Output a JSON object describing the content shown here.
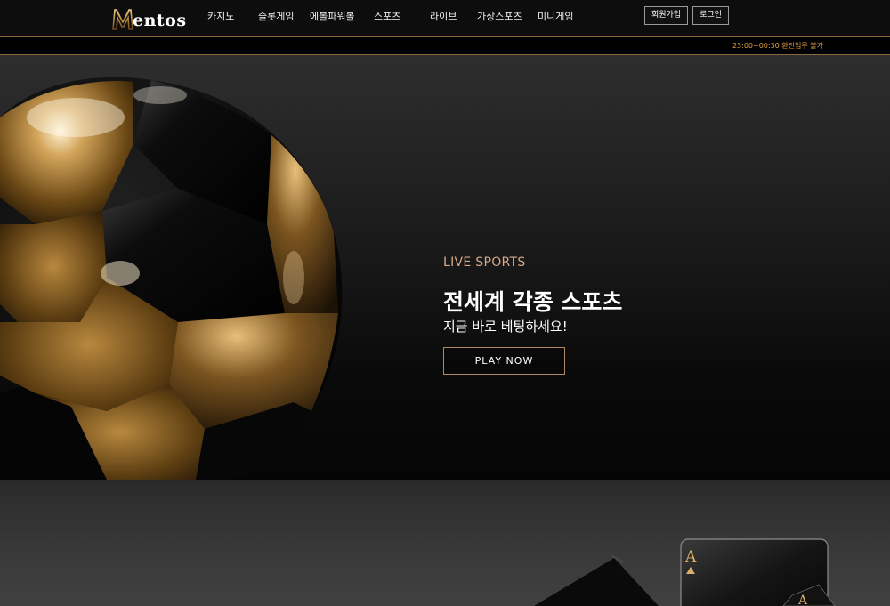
{
  "brand": {
    "logo_text": "Mentos",
    "logo_rest": "entos",
    "accent_color": "#b08a66",
    "notice_color": "#e0a040"
  },
  "nav": {
    "items": [
      "카지노",
      "슬롯게임",
      "에볼파워볼",
      "스포츠",
      "라이브",
      "가상스포츠",
      "미니게임"
    ]
  },
  "auth": {
    "signup_label": "회원가입",
    "login_label": "로그인"
  },
  "notice": {
    "text": "23:00~00:30 환전업무 불가"
  },
  "hero": {
    "subtitle": "LIVE SPORTS",
    "title": "전세계 각종 스포츠",
    "description": "지금 바로 베팅하세요!",
    "cta_label": "PLAY NOW"
  },
  "icons": {
    "hero_image": "soccer-ball-icon",
    "section2_image": "playing-cards-icon"
  }
}
